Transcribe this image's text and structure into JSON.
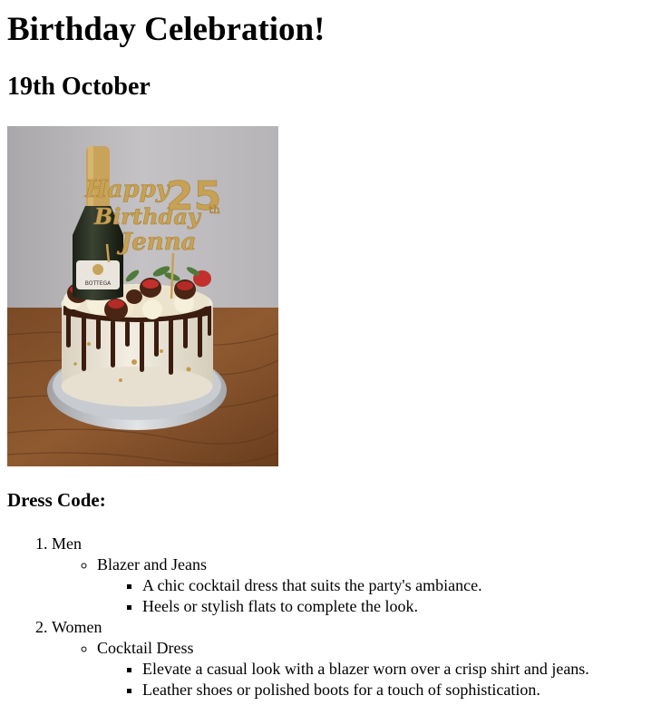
{
  "title": "Birthday Celebration!",
  "date": "19th October",
  "photo": {
    "topper_line1": "Happy",
    "topper_line2": "Birthday",
    "topper_line3": "Jenna",
    "topper_age": "25",
    "topper_suffix": "th",
    "bottle_label": "BOTTEGA"
  },
  "dress_code": {
    "heading": "Dress Code:",
    "groups": [
      {
        "label": "Men",
        "item": "Blazer and Jeans",
        "details": [
          "A chic cocktail dress that suits the party's ambiance.",
          "Heels or stylish flats to complete the look."
        ]
      },
      {
        "label": "Women",
        "item": "Cocktail Dress",
        "details": [
          "Elevate a casual look with a blazer worn over a crisp shirt and jeans.",
          "Leather shoes or polished boots for a touch of sophistication."
        ]
      }
    ]
  }
}
